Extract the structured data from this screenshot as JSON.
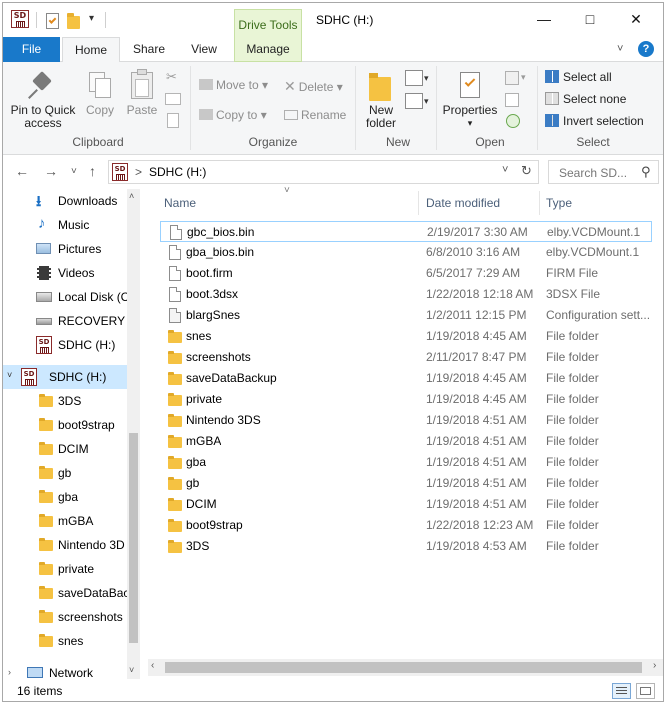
{
  "titlebar": {
    "drive_tools_label": "Drive Tools",
    "window_title": "SDHC (H:)",
    "minimize_glyph": "—",
    "maximize_glyph": "□",
    "close_glyph": "✕",
    "sd_icon_text": "SD"
  },
  "tabs": {
    "file": "File",
    "home": "Home",
    "share": "Share",
    "view": "View",
    "manage": "Manage"
  },
  "ribbon": {
    "clipboard": {
      "pin_label_line1": "Pin to Quick",
      "pin_label_line2": "access",
      "copy": "Copy",
      "paste": "Paste",
      "group_label": "Clipboard"
    },
    "organize": {
      "move_to": "Move to",
      "copy_to": "Copy to",
      "delete": "Delete",
      "rename": "Rename",
      "group_label": "Organize"
    },
    "new": {
      "new_folder_line1": "New",
      "new_folder_line2": "folder",
      "group_label": "New"
    },
    "open": {
      "properties": "Properties",
      "group_label": "Open"
    },
    "select": {
      "select_all": "Select all",
      "select_none": "Select none",
      "invert_selection": "Invert selection",
      "group_label": "Select"
    }
  },
  "address": {
    "path_label": "SDHC (H:)",
    "breadcrumb_sep": ">",
    "search_placeholder": "Search SD..."
  },
  "nav_pane": {
    "items": [
      {
        "label": "Downloads",
        "icon": "download-arrow-icon"
      },
      {
        "label": "Music",
        "icon": "music-note-icon"
      },
      {
        "label": "Pictures",
        "icon": "pictures-icon"
      },
      {
        "label": "Videos",
        "icon": "film-icon"
      },
      {
        "label": "Local Disk (C",
        "icon": "local-disk-icon"
      },
      {
        "label": "RECOVERY (D",
        "icon": "drive-icon"
      },
      {
        "label": "SDHC (H:)",
        "icon": "sd-card-icon"
      }
    ],
    "tree": {
      "drive_label": "SDHC (H:)",
      "folders": [
        "3DS",
        "boot9strap",
        "DCIM",
        "gb",
        "gba",
        "mGBA",
        "Nintendo 3D",
        "private",
        "saveDataBacl",
        "screenshots",
        "snes"
      ]
    },
    "network_label": "Network"
  },
  "file_list": {
    "columns": {
      "name": "Name",
      "date": "Date modified",
      "type": "Type"
    },
    "rows": [
      {
        "name": "gbc_bios.bin",
        "date": "2/19/2017 3:30 AM",
        "type": "elby.VCDMount.1",
        "kind": "file"
      },
      {
        "name": "gba_bios.bin",
        "date": "6/8/2010 3:16 AM",
        "type": "elby.VCDMount.1",
        "kind": "file"
      },
      {
        "name": "boot.firm",
        "date": "6/5/2017 7:29 AM",
        "type": "FIRM File",
        "kind": "file"
      },
      {
        "name": "boot.3dsx",
        "date": "1/22/2018 12:18 AM",
        "type": "3DSX File",
        "kind": "file"
      },
      {
        "name": "blargSnes",
        "date": "1/2/2011 12:15 PM",
        "type": "Configuration sett...",
        "kind": "config"
      },
      {
        "name": "snes",
        "date": "1/19/2018 4:45 AM",
        "type": "File folder",
        "kind": "folder"
      },
      {
        "name": "screenshots",
        "date": "2/11/2017 8:47 PM",
        "type": "File folder",
        "kind": "folder"
      },
      {
        "name": "saveDataBackup",
        "date": "1/19/2018 4:45 AM",
        "type": "File folder",
        "kind": "folder"
      },
      {
        "name": "private",
        "date": "1/19/2018 4:45 AM",
        "type": "File folder",
        "kind": "folder"
      },
      {
        "name": "Nintendo 3DS",
        "date": "1/19/2018 4:51 AM",
        "type": "File folder",
        "kind": "folder"
      },
      {
        "name": "mGBA",
        "date": "1/19/2018 4:51 AM",
        "type": "File folder",
        "kind": "folder"
      },
      {
        "name": "gba",
        "date": "1/19/2018 4:51 AM",
        "type": "File folder",
        "kind": "folder"
      },
      {
        "name": "gb",
        "date": "1/19/2018 4:51 AM",
        "type": "File folder",
        "kind": "folder"
      },
      {
        "name": "DCIM",
        "date": "1/19/2018 4:51 AM",
        "type": "File folder",
        "kind": "folder"
      },
      {
        "name": "boot9strap",
        "date": "1/22/2018 12:23 AM",
        "type": "File folder",
        "kind": "folder"
      },
      {
        "name": "3DS",
        "date": "1/19/2018 4:53 AM",
        "type": "File folder",
        "kind": "folder"
      }
    ]
  },
  "status": {
    "item_count": "16 items"
  },
  "colors": {
    "accent": "#1979ca",
    "drive_tools_bg": "#e9f5d6",
    "folder_yellow": "#f5c242",
    "selection": "#cce8ff"
  }
}
